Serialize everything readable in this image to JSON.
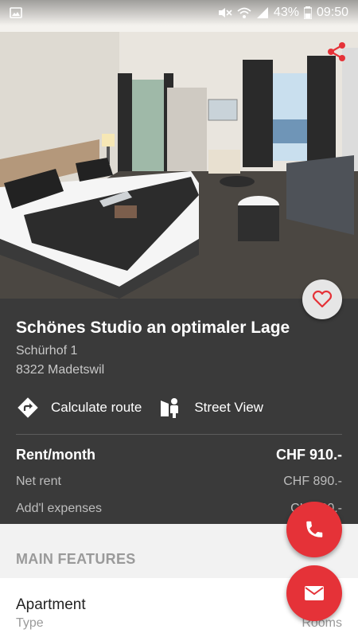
{
  "status_bar": {
    "battery": "43%",
    "time": "09:50"
  },
  "listing": {
    "title": "Schönes Studio an optimaler Lage",
    "street": "Schürhof 1",
    "city": "8322 Madetswil"
  },
  "actions": {
    "route_label": "Calculate route",
    "street_view_label": "Street View"
  },
  "pricing": {
    "rent_label": "Rent/month",
    "rent_value": "CHF 910.-",
    "net_label": "Net rent",
    "net_value": "CHF 890.-",
    "expenses_label": "Add'l expenses",
    "expenses_value": "CHF 20.-"
  },
  "features": {
    "section_title": "MAIN FEATURES",
    "type_value": "Apartment",
    "type_label": "Type",
    "rooms_label": "Rooms"
  },
  "colors": {
    "accent": "#e53238",
    "dark_panel": "#3a3a3a",
    "features_bg": "#f2f2f2"
  },
  "icons": {
    "share": "share-icon",
    "favorite": "heart-outline-icon",
    "route": "directions-icon",
    "street_view": "street-view-icon",
    "call": "phone-icon",
    "mail": "mail-icon"
  }
}
